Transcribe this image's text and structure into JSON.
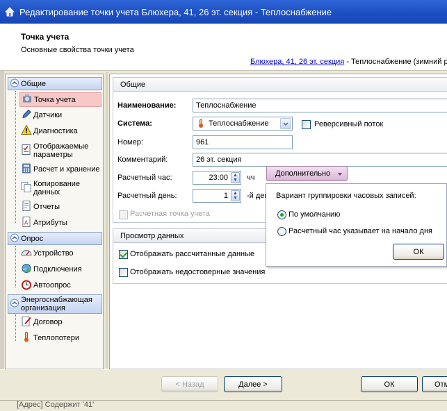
{
  "window": {
    "title": "Редактирование точки учета Блюхера, 41, 26 эт. секция - Теплоснабжение"
  },
  "header": {
    "title": "Точка учета",
    "subtitle": "Основные свойства точки учета",
    "link": "Блюхера, 41, 26 эт. секция",
    "link_suffix": " - Теплоснабжение (зимний р"
  },
  "sidebar": {
    "groups": [
      {
        "label": "Общие",
        "items": [
          "Точка учета",
          "Датчики",
          "Диагностика",
          "Отображаемые параметры",
          "Расчет и хранение",
          "Копирование данных",
          "Отчеты",
          "Атрибуты"
        ]
      },
      {
        "label": "Опрос",
        "items": [
          "Устройство",
          "Подключения",
          "Автоопрос"
        ]
      },
      {
        "label": "Энергоснабжающая организация",
        "items": [
          "Договор",
          "Теплопотери"
        ]
      }
    ]
  },
  "general": {
    "header": "Общие",
    "name_label": "Наименование:",
    "name_value": "Теплоснабжение",
    "system_label": "Система:",
    "system_value": "Теплоснабжение",
    "reverse_label": "Реверсивный поток",
    "reverse_checked": false,
    "number_label": "Номер:",
    "number_value": "961",
    "comment_label": "Комментарий:",
    "comment_value": "26 эт. секция",
    "hour_label": "Расчетный час:",
    "hour_value": "23:00",
    "hour_unit": "чч",
    "day_label": "Расчетный день:",
    "day_value": "1",
    "day_unit": "-й ден",
    "calc_point_label": "Расчетная точка учета",
    "more_button": "Дополнительно"
  },
  "view": {
    "header": "Просмотр данных",
    "show_calculated": "Отображать рассчитанные данные",
    "show_calculated_checked": true,
    "show_unreliable": "Отображать недостоверные значения",
    "show_unreliable_checked": false
  },
  "popup": {
    "title": "Вариант группировки часовых записей:",
    "option_default": "По умолчанию",
    "option_start": "Расчетный час указывает на начало дня",
    "selected": "По умолчанию",
    "ok": "ОК"
  },
  "footer": {
    "back": "< Назад",
    "next": "Далее >",
    "ok": "ОК",
    "cancel": "Отм"
  },
  "status": {
    "text": "[Адрес] Содержит '41'"
  }
}
